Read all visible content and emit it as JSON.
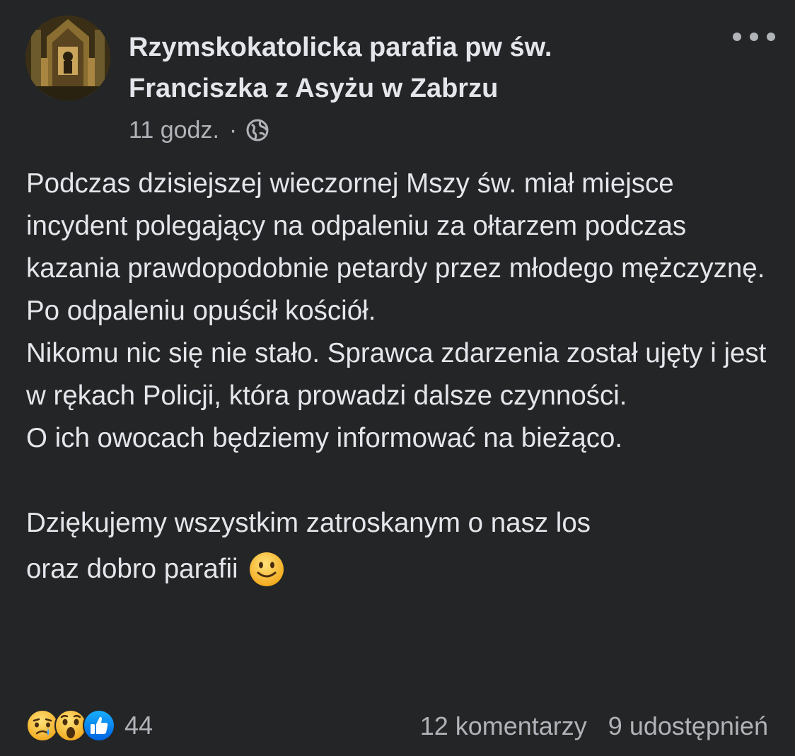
{
  "post": {
    "page_name": "Rzymskokatolicka parafia pw św. Franciszka z Asyżu w Zabrzu",
    "time": "11 godz.",
    "separator": "·",
    "privacy_icon": "globe-icon",
    "more_icon": "more-options-icon",
    "paragraphs": [
      "Podczas dzisiejszej wieczornej Mszy św. miał miejsce incydent polegający na odpaleniu za ołtarzem podczas kazania prawdopodobnie petardy przez młodego mężczyznę. Po odpaleniu opuścił kościół.",
      "Nikomu nic się nie stało. Sprawca zdarzenia został ujęty i jest w rękach Policji, która prowadzi dalsze czynności.",
      "O ich owocach będziemy informować na bieżąco.",
      "Dziękujemy wszystkim zatroskanym o nasz los",
      "oraz dobro parafii"
    ],
    "emoji": "slightly-smiling-face-icon"
  },
  "footer": {
    "reaction_icons": [
      "sad-reaction-icon",
      "wow-reaction-icon",
      "like-reaction-icon"
    ],
    "reaction_count": "44",
    "comments": "12 komentarzy",
    "shares": "9 udostępnień"
  },
  "colors": {
    "background": "#242526",
    "text_primary": "#e4e6eb",
    "text_secondary": "#b0b3b8",
    "like_blue": "#1877f2",
    "emoji_yellow": "#f7c23a"
  }
}
